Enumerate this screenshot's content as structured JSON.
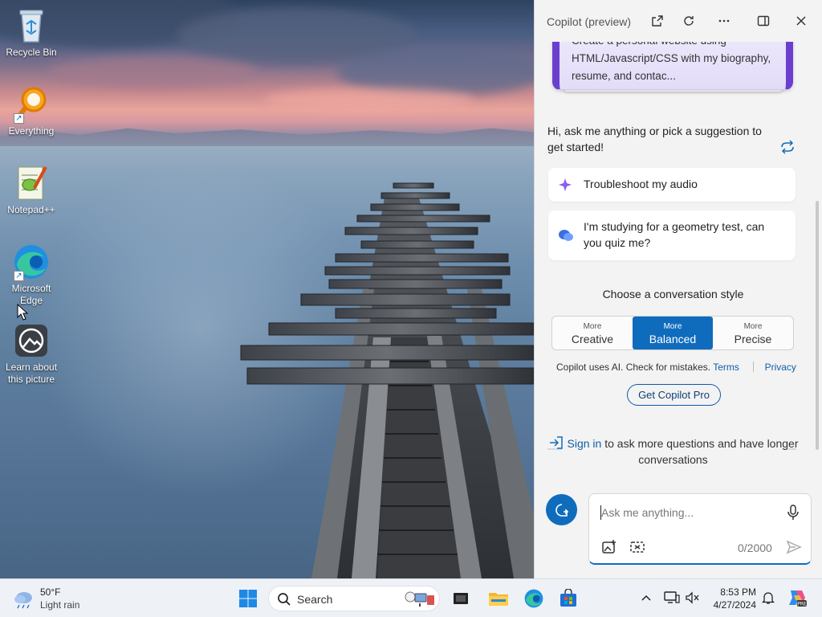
{
  "desktop": {
    "icons": [
      {
        "label": "Recycle Bin"
      },
      {
        "label": "Everything"
      },
      {
        "label": "Notepad++"
      },
      {
        "label": "Microsoft Edge"
      },
      {
        "label": "Learn about this picture"
      }
    ]
  },
  "copilot": {
    "title": "Copilot (preview)",
    "header_buttons": [
      "open-in-new-window-icon",
      "refresh-icon",
      "more-options-icon",
      "split-view-icon",
      "close-icon"
    ],
    "prompt_card_text": "Create a personal website using HTML/Javascript/CSS with my biography, resume, and contac...",
    "greeting": "Hi, ask me anything or pick a suggestion to get started!",
    "suggestions": [
      {
        "icon": "sparkle-icon",
        "text": "Troubleshoot my audio"
      },
      {
        "icon": "chat-bubbles-icon",
        "text": "I'm studying for a geometry test, can you quiz me?"
      }
    ],
    "conversation_style": {
      "label": "Choose a conversation style",
      "options": [
        {
          "sub": "More",
          "main": "Creative"
        },
        {
          "sub": "More",
          "main": "Balanced"
        },
        {
          "sub": "More",
          "main": "Precise"
        }
      ],
      "selected": "Balanced"
    },
    "disclaimer": "Copilot uses AI. Check for mistakes.",
    "terms_link": "Terms",
    "privacy_link": "Privacy",
    "pro_button": "Get Copilot Pro",
    "signin_link": "Sign in",
    "signin_rest": "to ask more questions and have longer conversations",
    "input": {
      "placeholder": "Ask me anything...",
      "value": "",
      "char_count": "0/2000"
    },
    "accent_color": "#0f6cbd",
    "card_accent_color": "#6a3fd0"
  },
  "taskbar": {
    "weather": {
      "temp": "50°F",
      "desc": "Light rain"
    },
    "search_label": "Search",
    "pinned": [
      "start-icon",
      "file-explorer-icon",
      "edge-icon",
      "store-icon",
      "task-view-icon"
    ],
    "tray": [
      "chevron-up-icon",
      "display-icon",
      "volume-icon",
      "notification-icon",
      "copilot-icon"
    ],
    "time": "8:53 PM",
    "date": "4/27/2024"
  }
}
